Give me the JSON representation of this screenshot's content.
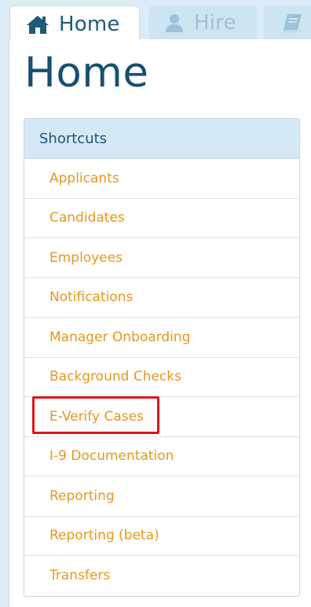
{
  "tabs": [
    {
      "label": "Home",
      "icon": "home-icon",
      "active": true
    },
    {
      "label": "Hire",
      "icon": "user-icon",
      "active": false
    },
    {
      "label": "",
      "icon": "book-icon",
      "active": false
    }
  ],
  "page": {
    "title": "Home"
  },
  "shortcuts": {
    "header": "Shortcuts",
    "items": [
      "Applicants",
      "Candidates",
      "Employees",
      "Notifications",
      "Manager Onboarding",
      "Background Checks",
      "E-Verify Cases",
      "I-9 Documentation",
      "Reporting",
      "Reporting (beta)",
      "Transfers"
    ]
  },
  "colors": {
    "accent": "#17506f",
    "link": "#e8961a",
    "highlight": "#e0141c",
    "header_bg": "#d4e8f5"
  }
}
